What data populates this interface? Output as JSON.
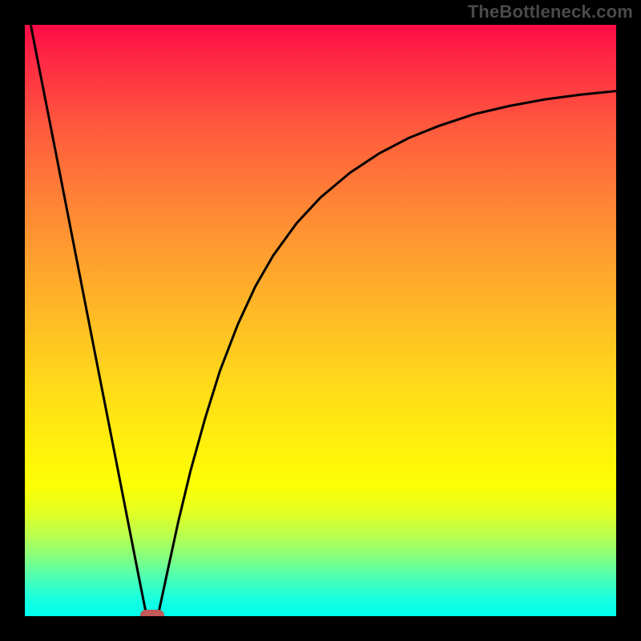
{
  "watermark": "TheBottleneck.com",
  "colors": {
    "frame_bg": "#000000",
    "curve_stroke": "#000000",
    "marker_fill": "#c55a5a"
  },
  "chart_data": {
    "type": "line",
    "title": "",
    "xlabel": "",
    "ylabel": "",
    "xlim": [
      0,
      100
    ],
    "ylim": [
      0,
      100
    ],
    "grid": false,
    "legend": false,
    "marker": {
      "x": 21.5,
      "y": 0
    },
    "series": [
      {
        "name": "left-descent",
        "x": [
          1.0,
          2.5,
          5.0,
          7.5,
          10.0,
          12.5,
          15.0,
          17.5,
          19.5,
          20.6
        ],
        "y": [
          100,
          92.3,
          79.6,
          66.8,
          54.0,
          41.2,
          28.5,
          15.7,
          5.5,
          0.0
        ]
      },
      {
        "name": "right-ascent",
        "x": [
          22.5,
          24.0,
          26.0,
          28.0,
          30.5,
          33.0,
          36.0,
          39.0,
          42.0,
          46.0,
          50.0,
          55.0,
          60.0,
          65.0,
          70.0,
          76.0,
          82.0,
          88.0,
          94.0,
          100.0
        ],
        "y": [
          0.0,
          7.0,
          16.2,
          24.5,
          33.5,
          41.5,
          49.3,
          55.8,
          61.0,
          66.5,
          70.8,
          75.0,
          78.3,
          80.9,
          82.9,
          84.9,
          86.3,
          87.4,
          88.2,
          88.8
        ]
      }
    ]
  }
}
